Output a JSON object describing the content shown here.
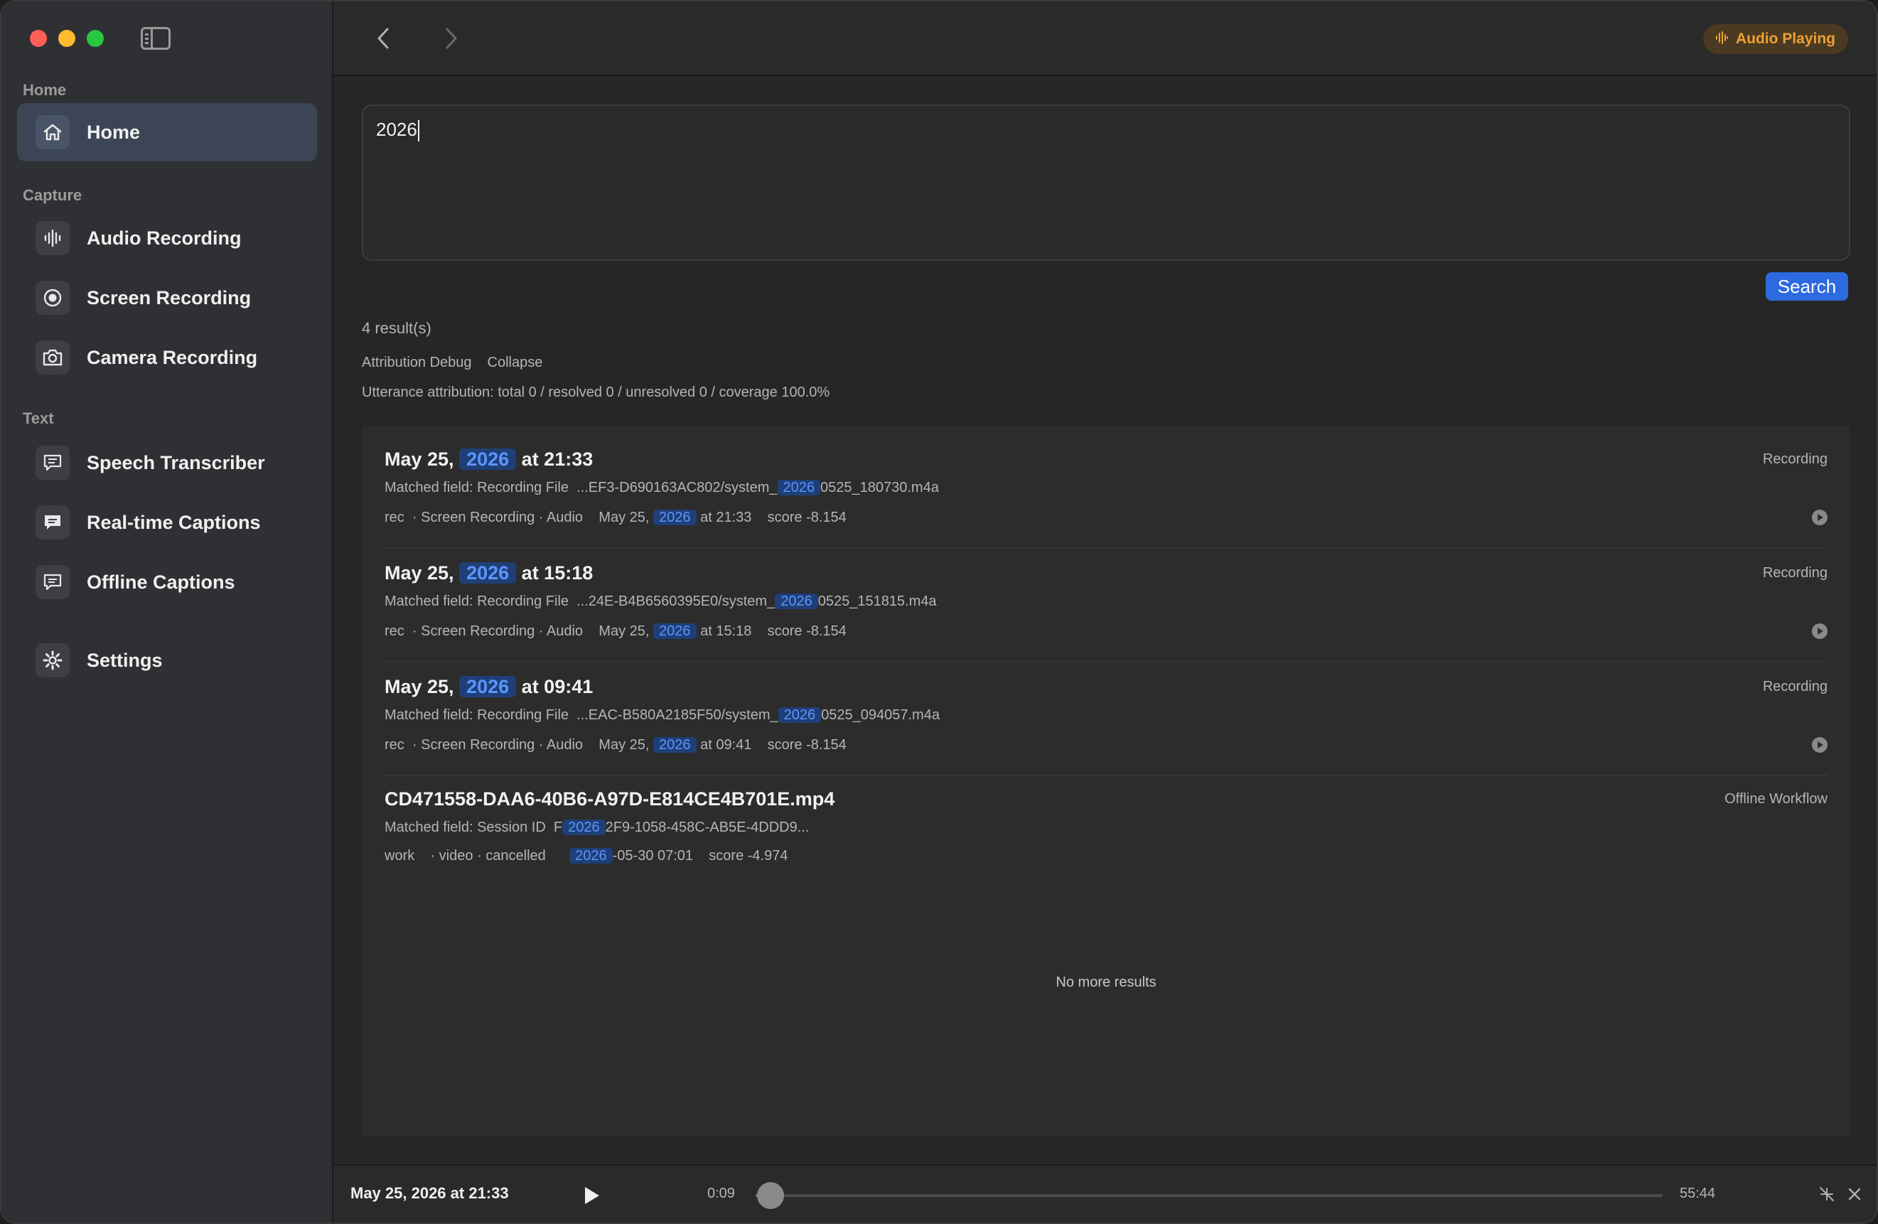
{
  "sidebar": {
    "sections": {
      "home": "Home",
      "capture": "Capture",
      "text": "Text"
    },
    "items": [
      {
        "label": "Home",
        "icon": "house-icon",
        "active": true
      },
      {
        "label": "Audio Recording",
        "icon": "waveform-icon"
      },
      {
        "label": "Screen Recording",
        "icon": "record-icon"
      },
      {
        "label": "Camera Recording",
        "icon": "camera-icon"
      },
      {
        "label": "Speech Transcriber",
        "icon": "speech-bubble-icon"
      },
      {
        "label": "Real-time Captions",
        "icon": "captions-icon"
      },
      {
        "label": "Offline Captions",
        "icon": "offline-captions-icon"
      },
      {
        "label": "Settings",
        "icon": "gear-icon"
      }
    ]
  },
  "topbar": {
    "audio_status": "Audio Playing",
    "accent": "#f0a032"
  },
  "search": {
    "query": "2026",
    "button_label": "Search"
  },
  "results_header": {
    "count": "4 result(s)",
    "attribution_debug": "Attribution Debug",
    "collapse": "Collapse",
    "attribution_summary": "Utterance attribution: total 0 / resolved 0 / unresolved 0 / coverage 100.0%"
  },
  "highlight": "2026",
  "results": [
    {
      "title_pre": "May 25,",
      "title_post": "at 21:33",
      "type": "Recording",
      "field_label": "Matched field: Recording File",
      "field_pre": "...EF3-D690163AC802/system_",
      "field_post": "0525_180730.m4a",
      "meta_tag": "rec",
      "meta_src": "· Screen Recording · Audio",
      "meta_date_pre": "May 25,",
      "meta_date_post": "at 21:33",
      "score": "score -8.154"
    },
    {
      "title_pre": "May 25,",
      "title_post": "at 15:18",
      "type": "Recording",
      "field_label": "Matched field: Recording File",
      "field_pre": "...24E-B4B6560395E0/system_",
      "field_post": "0525_151815.m4a",
      "meta_tag": "rec",
      "meta_src": "· Screen Recording · Audio",
      "meta_date_pre": "May 25,",
      "meta_date_post": "at 15:18",
      "score": "score -8.154"
    },
    {
      "title_pre": "May 25,",
      "title_post": "at 09:41",
      "type": "Recording",
      "field_label": "Matched field: Recording File",
      "field_pre": "...EAC-B580A2185F50/system_",
      "field_post": "0525_094057.m4a",
      "meta_tag": "rec",
      "meta_src": "· Screen Recording · Audio",
      "meta_date_pre": "May 25,",
      "meta_date_post": "at 09:41",
      "score": "score -8.154"
    },
    {
      "title": "CD471558-DAA6-40B6-A97D-E814CE4B701E.mp4",
      "type": "Offline Workflow",
      "field_label": "Matched field: Session ID",
      "field_pre": "F",
      "field_post": "2F9-1058-458C-AB5E-4DDD9...",
      "meta_tag": "work",
      "meta_src": "· video · cancelled",
      "meta_date_post": "-05-30 07:01",
      "score": "score -4.974"
    }
  ],
  "no_more": "No more results",
  "player": {
    "title": "May 25, 2026 at 21:33",
    "elapsed": "0:09",
    "duration": "55:44",
    "progress": 0.003
  }
}
